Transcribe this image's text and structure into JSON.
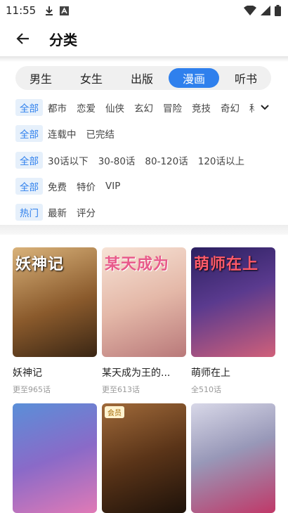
{
  "status_bar": {
    "time": "11:55"
  },
  "header": {
    "title": "分类"
  },
  "tabs": [
    {
      "label": "男生",
      "active": false
    },
    {
      "label": "女生",
      "active": false
    },
    {
      "label": "出版",
      "active": false
    },
    {
      "label": "漫画",
      "active": true
    },
    {
      "label": "听书",
      "active": false
    }
  ],
  "filters": {
    "genre": {
      "selected": "全部",
      "options": [
        "都市",
        "恋爱",
        "仙侠",
        "玄幻",
        "冒险",
        "竞技",
        "奇幻",
        "科"
      ]
    },
    "status": {
      "selected": "全部",
      "options": [
        "连载中",
        "已完结"
      ]
    },
    "length": {
      "selected": "全部",
      "options": [
        "30话以下",
        "30-80话",
        "80-120话",
        "120话以上"
      ]
    },
    "price": {
      "selected": "全部",
      "options": [
        "免费",
        "特价",
        "VIP"
      ]
    },
    "sort": {
      "selected": "热门",
      "options": [
        "最新",
        "评分"
      ]
    }
  },
  "books": [
    {
      "title": "妖神记",
      "subtitle": "更至965话",
      "cover_text": "妖神记",
      "colors": [
        "#c9a06a",
        "#7a4a24"
      ]
    },
    {
      "title": "某天成为王的...",
      "subtitle": "更至613话",
      "cover_text": "某天成为",
      "colors": [
        "#f4d9c8",
        "#c98b7d"
      ]
    },
    {
      "title": "萌师在上",
      "subtitle": "全510话",
      "cover_text": "萌师在上",
      "colors": [
        "#3b2a6e",
        "#c84a6a"
      ]
    },
    {
      "title": "",
      "subtitle": "",
      "cover_text": "",
      "colors": [
        "#4a7fc9",
        "#d07ab6"
      ]
    },
    {
      "title": "",
      "subtitle": "",
      "cover_text": "",
      "colors": [
        "#8c5a2c",
        "#2b1a10"
      ],
      "badge": "会员"
    },
    {
      "title": "",
      "subtitle": "",
      "cover_text": "",
      "colors": [
        "#c8c8d8",
        "#b03060"
      ]
    }
  ]
}
